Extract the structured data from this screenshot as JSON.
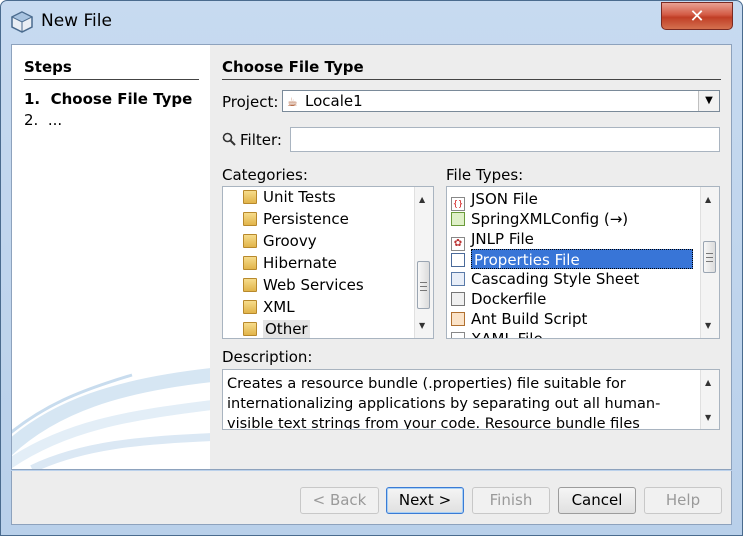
{
  "window": {
    "title": "New File",
    "close_glyph": "✕"
  },
  "steps": {
    "heading": "Steps",
    "items": [
      {
        "number": "1.",
        "label": "Choose File Type"
      },
      {
        "number": "2.",
        "label": "..."
      }
    ]
  },
  "main": {
    "heading": "Choose File Type",
    "project_label": "Project:",
    "project_value": "Locale1",
    "filter_label": "Filter:",
    "filter_value": "",
    "categories_label": "Categories:",
    "categories": [
      "Unit Tests",
      "Persistence",
      "Groovy",
      "Hibernate",
      "Web Services",
      "XML",
      "Other"
    ],
    "categories_selected": "Other",
    "file_types_label": "File Types:",
    "file_types": [
      "JSON File",
      "SpringXMLConfig (→)",
      "JNLP File",
      "Properties File",
      "Cascading Style Sheet",
      "Dockerfile",
      "Ant Build Script",
      "XAML File"
    ],
    "file_types_selected": "Properties File",
    "description_label": "Description:",
    "description": "Creates a resource bundle (.properties) file suitable for internationalizing applications by separating out all human-visible text strings from your code. Resource bundle files"
  },
  "buttons": {
    "back": "< Back",
    "next": "Next >",
    "finish": "Finish",
    "cancel": "Cancel",
    "help": "Help"
  },
  "icons": {
    "app": "netbeans-cube-icon",
    "search": "magnifier-icon",
    "folder": "folder-icon"
  }
}
